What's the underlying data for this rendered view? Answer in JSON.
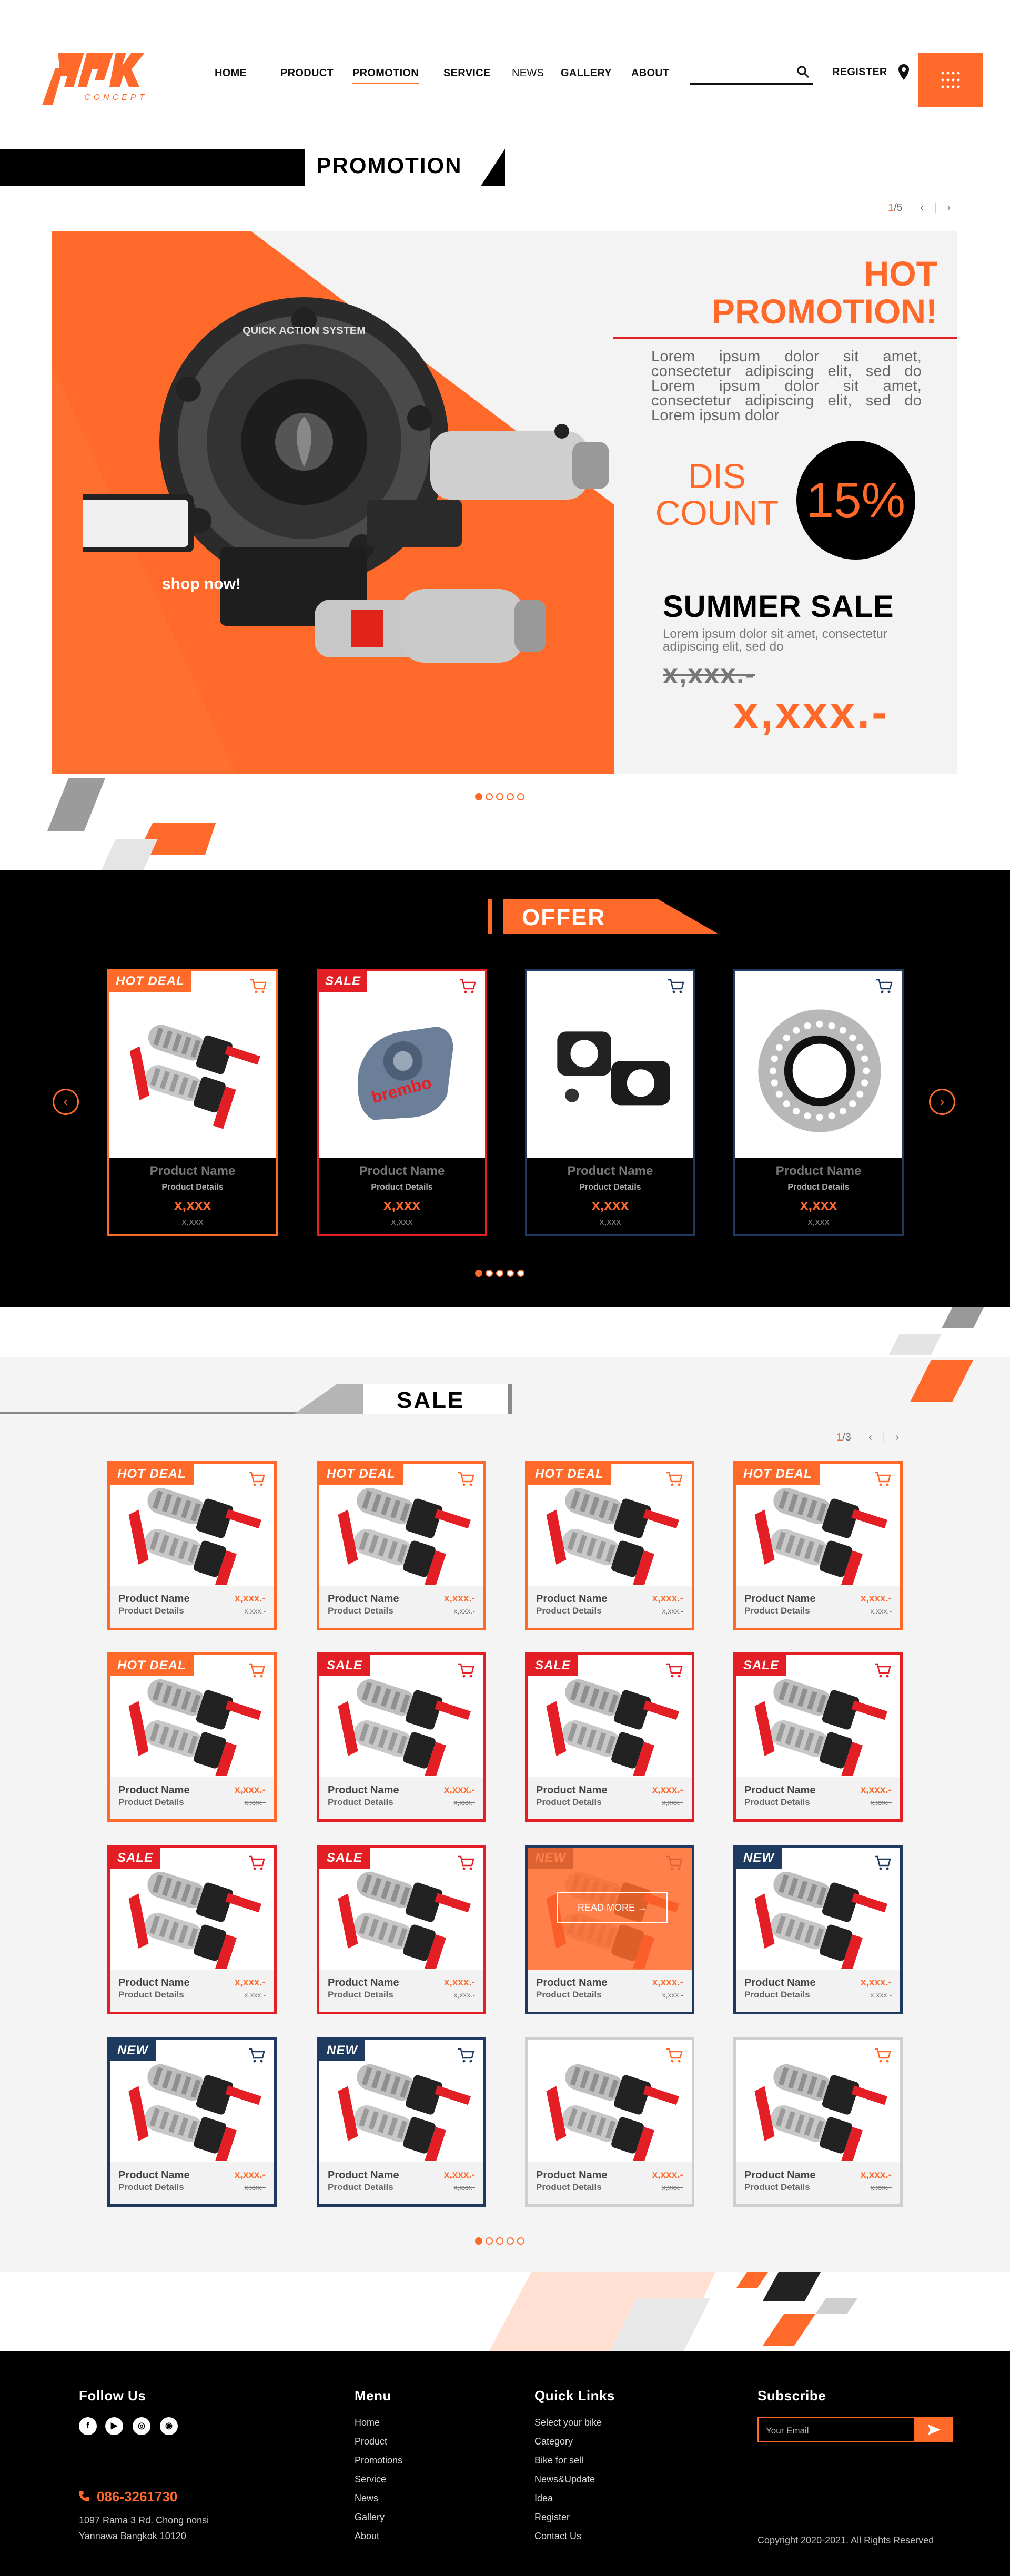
{
  "colors": {
    "accent": "#ff6a2a",
    "dark": "#000000",
    "navy": "#1f3a5f",
    "red": "#e31e24",
    "grey": "#cfcfcf"
  },
  "brand": {
    "logo_text": "PPK",
    "logo_sub": "CONCEPT"
  },
  "nav": {
    "items": [
      "HOME",
      "PRODUCT",
      "PROMOTION",
      "SERVICE",
      "NEWS",
      "GALLERY",
      "ABOUT"
    ],
    "active": "PROMOTION",
    "register": "REGISTER",
    "search_icon": "search-icon",
    "location_icon": "location-pin-icon",
    "menu_icon": "grid-menu-icon"
  },
  "promotion": {
    "section_title": "PROMOTION",
    "pager": {
      "current": "1",
      "total": "/5"
    },
    "hero": {
      "headline_1": "HOT",
      "headline_2": "PROMOTION!",
      "lorem": "Lorem ipsum dolor sit amet, consectetur adipiscing elit, sed do Lorem ipsum dolor sit amet, consectetur adipiscing elit, sed do Lorem ipsum dolor",
      "discount_word_1": "DIS",
      "discount_word_2": "COUNT",
      "discount_value": "15%",
      "sale_title": "SUMMER SALE",
      "sale_lorem": "Lorem ipsum dolor sit amet, consectetur adipiscing elit, sed do",
      "old_price": "x,xxx.-",
      "new_price": "x,xxx.-",
      "cta": "shop now!",
      "wheel_text": "QUICK ACTION SYSTEM"
    },
    "dots": 5
  },
  "offer": {
    "title": "OFFER",
    "cards": [
      {
        "badge": "HOT DEAL",
        "name": "Product Name",
        "details": "Product Details",
        "price": "x,xxx",
        "old": "x,xxx",
        "style": "hot",
        "img": "footpeg"
      },
      {
        "badge": "SALE",
        "name": "Product Name",
        "details": "Product Details",
        "price": "x,xxx",
        "old": "x,xxx",
        "style": "sale",
        "img": "caliper"
      },
      {
        "badge": "",
        "name": "Product Name",
        "details": "Product Details",
        "price": "x,xxx",
        "old": "x,xxx",
        "style": "new",
        "img": "bracket"
      },
      {
        "badge": "",
        "name": "Product Name",
        "details": "Product Details",
        "price": "x,xxx",
        "old": "x,xxx",
        "style": "new",
        "img": "disc"
      }
    ],
    "dots": 5
  },
  "sale": {
    "title": "SALE",
    "pager": {
      "current": "1",
      "total": "/3"
    },
    "read_more": "READ MORE",
    "cards": [
      {
        "badge": "HOT DEAL",
        "style": "hot"
      },
      {
        "badge": "HOT DEAL",
        "style": "hot"
      },
      {
        "badge": "HOT DEAL",
        "style": "hot"
      },
      {
        "badge": "HOT DEAL",
        "style": "hot"
      },
      {
        "badge": "HOT DEAL",
        "style": "hot"
      },
      {
        "badge": "SALE",
        "style": "sale"
      },
      {
        "badge": "SALE",
        "style": "sale"
      },
      {
        "badge": "SALE",
        "style": "sale"
      },
      {
        "badge": "SALE",
        "style": "sale"
      },
      {
        "badge": "SALE",
        "style": "sale"
      },
      {
        "badge": "NEW",
        "style": "hover"
      },
      {
        "badge": "NEW",
        "style": "new"
      },
      {
        "badge": "NEW",
        "style": "new"
      },
      {
        "badge": "NEW",
        "style": "new"
      },
      {
        "badge": "",
        "style": "plain"
      },
      {
        "badge": "",
        "style": "plain"
      }
    ],
    "card_name": "Product Name",
    "card_details": "Product Details",
    "card_price": "x,xxx.-",
    "card_old": "x,xxx.-",
    "dots": 5
  },
  "footer": {
    "follow": "Follow Us",
    "social": [
      "f",
      "▶",
      "◎",
      "◉"
    ],
    "phone": "086-3261730",
    "address_1": "1097 Rama 3 Rd. Chong nonsi",
    "address_2": "Yannawa Bangkok 10120",
    "menu_title": "Menu",
    "menu": [
      "Home",
      "Product",
      "Promotions",
      "Service",
      "News",
      "Gallery",
      "About"
    ],
    "quick_title": "Quick Links",
    "quick": [
      "Select your bike",
      "Category",
      "Bike for sell",
      "News&Update",
      "Idea",
      "Register",
      "Contact Us"
    ],
    "subscribe_title": "Subscribe",
    "email_placeholder": "Your Email",
    "copyright": "Copyright 2020-2021. All Rights Reserved"
  }
}
